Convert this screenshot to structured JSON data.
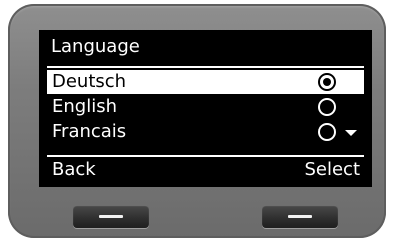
{
  "screen": {
    "title": "Language",
    "items": [
      {
        "label": "Deutsch",
        "selected": true,
        "checked": true
      },
      {
        "label": "English",
        "selected": false,
        "checked": false
      },
      {
        "label": "Francais",
        "selected": false,
        "checked": false
      }
    ],
    "has_more_below": true,
    "softkeys": {
      "left": "Back",
      "right": "Select"
    }
  },
  "colors": {
    "screen_background": "#000000",
    "text": "#ffffff",
    "highlight": "#ffffff",
    "device_body": "#7d7d7d"
  },
  "icons": {
    "radio_checked": "radio-checked-icon",
    "radio_unchecked": "radio-unchecked-icon",
    "scroll_down": "scroll-down-arrow-icon"
  }
}
